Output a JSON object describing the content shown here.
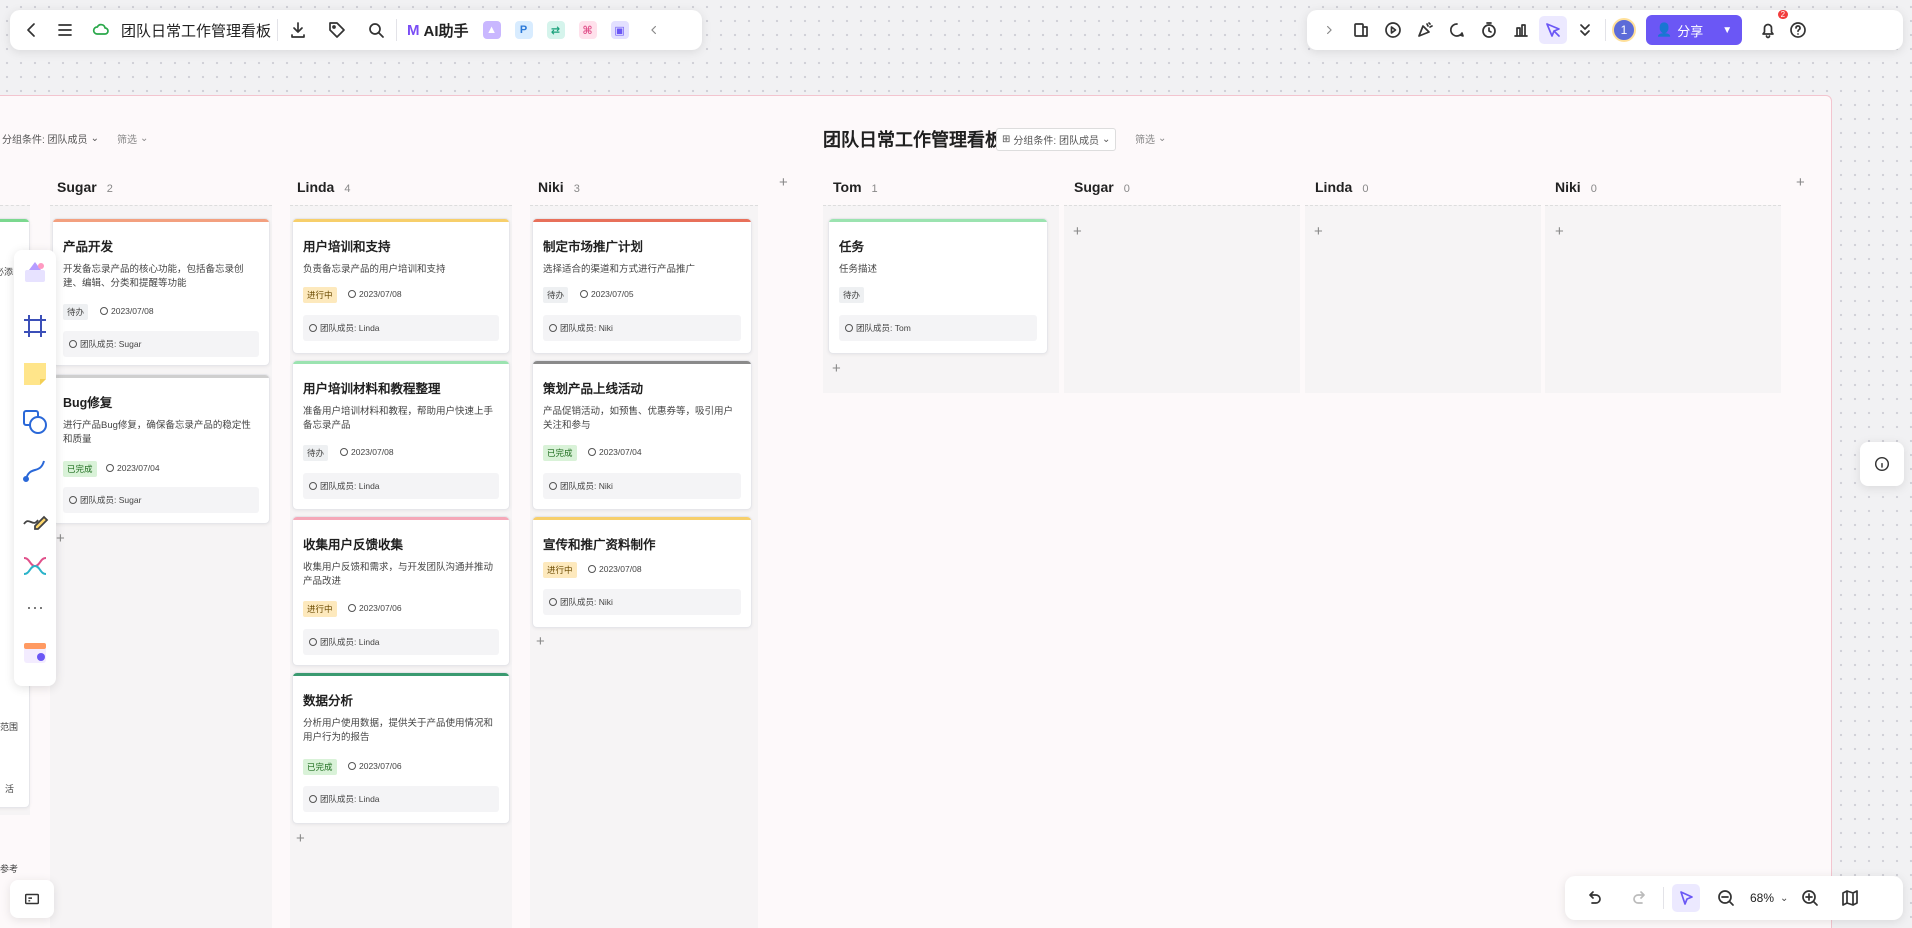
{
  "topbar": {
    "title": "团队日常工作管理看板",
    "ai_label": "AI助手"
  },
  "topright": {
    "avatar_label": "1",
    "share_label": "分享",
    "notify_count": "2"
  },
  "board": {
    "title": "团队日常工作管理看板",
    "group_label": "分组条件: 团队成员",
    "filter_label": "筛选"
  },
  "left_group": {
    "group_label": "分组条件: 团队成员",
    "filter_label": "筛选"
  },
  "partial_text": {
    "a": "必添",
    "b": "活",
    "c": "范围",
    "d": "参考"
  },
  "columns": [
    {
      "name": "Sugar",
      "count": "2"
    },
    {
      "name": "Linda",
      "count": "4"
    },
    {
      "name": "Niki",
      "count": "3"
    }
  ],
  "columns2": [
    {
      "name": "Tom",
      "count": "1"
    },
    {
      "name": "Sugar",
      "count": "0"
    },
    {
      "name": "Linda",
      "count": "0"
    },
    {
      "name": "Niki",
      "count": "0"
    }
  ],
  "cards": {
    "sugar": [
      {
        "title": "产品开发",
        "desc": "开发备忘录产品的核心功能，包括备忘录创建、编辑、分类和提醒等功能",
        "status": "待办",
        "date": "2023/07/08",
        "member": "团队成员: Sugar"
      },
      {
        "title": "Bug修复",
        "desc": "进行产品Bug修复，确保备忘录产品的稳定性和质量",
        "status": "已完成",
        "date": "2023/07/04",
        "member": "团队成员: Sugar"
      }
    ],
    "linda": [
      {
        "title": "用户培训和支持",
        "desc": "负责备忘录产品的用户培训和支持",
        "status": "进行中",
        "date": "2023/07/08",
        "member": "团队成员: Linda"
      },
      {
        "title": "用户培训材料和教程整理",
        "desc": "准备用户培训材料和教程，帮助用户快速上手备忘录产品",
        "status": "待办",
        "date": "2023/07/08",
        "member": "团队成员: Linda"
      },
      {
        "title": "收集用户反馈收集",
        "desc": "收集用户反馈和需求，与开发团队沟通并推动产品改进",
        "status": "进行中",
        "date": "2023/07/06",
        "member": "团队成员: Linda"
      },
      {
        "title": "数据分析",
        "desc": "分析用户使用数据，提供关于产品使用情况和用户行为的报告",
        "status": "已完成",
        "date": "2023/07/06",
        "member": "团队成员: Linda"
      }
    ],
    "niki": [
      {
        "title": "制定市场推广计划",
        "desc": "选择适合的渠道和方式进行产品推广",
        "status": "待办",
        "date": "2023/07/05",
        "member": "团队成员: Niki"
      },
      {
        "title": "策划产品上线活动",
        "desc": "产品促销活动，如预售、优惠券等，吸引用户关注和参与",
        "status": "已完成",
        "date": "2023/07/04",
        "member": "团队成员: Niki"
      },
      {
        "title": "宣传和推广资料制作",
        "desc": "",
        "status": "进行中",
        "date": "2023/07/08",
        "member": "团队成员: Niki"
      }
    ],
    "tom": [
      {
        "title": "任务",
        "desc": "任务描述",
        "status": "待办",
        "member": "团队成员: Tom"
      }
    ]
  },
  "zoom": {
    "level": "68%"
  },
  "colors": {
    "accent": "#6b57f5",
    "wait": "#eef0f2",
    "doing": "#fde9bd",
    "done": "#d9f2d8"
  },
  "icons": [
    "back-icon",
    "menu-icon",
    "cloud-icon",
    "download-icon",
    "tag-icon",
    "search-icon",
    "collapse-icon",
    "expand-icon",
    "template-icon",
    "play-icon",
    "celebrate-icon",
    "comment-icon",
    "timer-icon",
    "vote-icon",
    "laser-icon",
    "more-icon",
    "bell-icon",
    "help-icon",
    "info-icon",
    "undo-icon",
    "redo-icon",
    "pointer-icon",
    "zoom-out-icon",
    "zoom-in-icon",
    "map-icon",
    "minimap-icon"
  ]
}
